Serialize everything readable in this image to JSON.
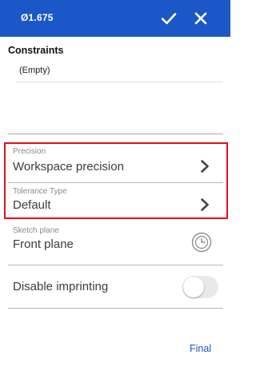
{
  "header": {
    "title": "Ø1.675",
    "accent_color": "#1b57c6",
    "confirm_icon": "checkmark-icon",
    "close_icon": "close-icon"
  },
  "constraints": {
    "title": "Constraints",
    "empty_text": "(Empty)"
  },
  "precision": {
    "label": "Precision",
    "value": "Workspace precision"
  },
  "tolerance": {
    "label": "Tolerance Type",
    "value": "Default"
  },
  "sketch_plane": {
    "label": "Sketch plane",
    "value": "Front plane",
    "icon": "clock-icon"
  },
  "imprinting": {
    "label": "Disable imprinting",
    "enabled": false
  },
  "footer": {
    "final_label": "Final"
  },
  "highlight_color": "#e3101c"
}
